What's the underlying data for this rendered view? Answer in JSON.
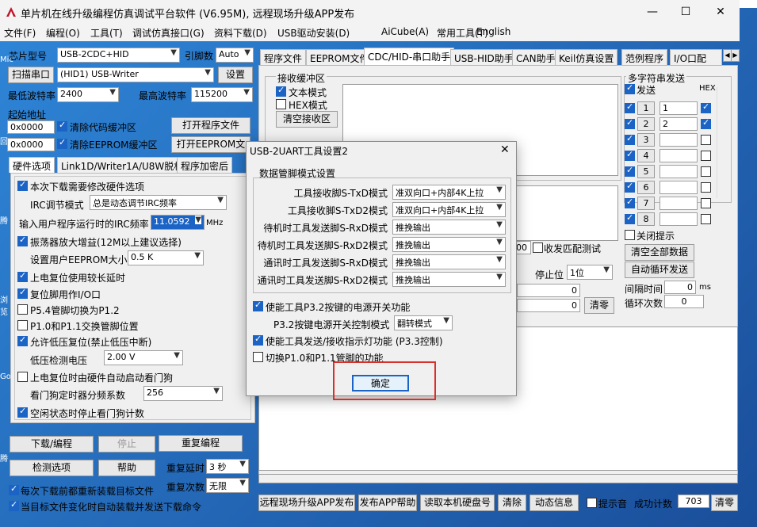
{
  "window": {
    "title": "单片机在线升级编程仿真调试平台软件 (V6.95M), 远程现场升级APP发布",
    "min": "—",
    "max": "☐",
    "close": "✕"
  },
  "desktop": {
    "icons": [
      "Mic",
      "回",
      "腾",
      "浏览",
      "Go",
      "腾"
    ]
  },
  "menu": [
    "文件(F)",
    "编程(O)",
    "工具(T)",
    "调试仿真接口(G)",
    "资料下载(D)",
    "USB驱动安装(D)",
    "AiCube(A)",
    "常用工具(T)",
    "English"
  ],
  "left": {
    "chip_label": "芯片型号",
    "chip_value": "USB-2CDC+HID",
    "pin_label": "引脚数",
    "pin_value": "Auto",
    "scan_button": "扫描串口",
    "port_value": "(HID1) USB-Writer",
    "settings_button": "设置",
    "min_baud_label": "最低波特率",
    "min_baud_value": "2400",
    "max_baud_label": "最高波特率",
    "max_baud_value": "115200",
    "start_addr_label": "起始地址",
    "addr1": "0x0000",
    "clear_code": "清除代码缓冲区",
    "open_prog": "打开程序文件",
    "addr2": "0x0000",
    "clear_eeprom": "清除EEPROM缓冲区",
    "open_eeprom": "打开EEPROM文",
    "tabs": [
      "硬件选项",
      "Link1D/Writer1A/U8W脱机",
      "程序加密后"
    ],
    "options": {
      "modify_hw": "本次下载需要修改硬件选项",
      "irc_label": "IRC调节模式",
      "irc_value": "总是动态调节IRC频率",
      "freq_label": "输入用户程序运行时的IRC频率",
      "freq_value": "11.0592",
      "freq_unit": "MHz",
      "osc_gain": "振荡器放大增益(12M以上建议选择)",
      "eeprom_label": "设置用户EEPROM大小",
      "eeprom_value": "0.5 K",
      "power_delay": "上电复位使用较长延时",
      "reset_io": "复位脚用作I/O口",
      "p54": "P5.4管脚切换为P1.2",
      "p10": "P1.0和P1.1交换管脚位置",
      "low_volt": "允许低压复位(禁止低压中断)",
      "low_volt_label": "低压检测电压",
      "low_volt_value": "2.00 V",
      "watchdog": "上电复位时由硬件自动启动看门狗",
      "wd_label": "看门狗定时器分频系数",
      "wd_value": "256",
      "idle_wd": "空闲状态时停止看门狗计数"
    },
    "download": "下载/编程",
    "stop": "停止",
    "reprog": "重复编程",
    "check": "检测选项",
    "help": "帮助",
    "repeat_delay_label": "重复延时",
    "repeat_delay_value": "3 秒",
    "repeat_count_label": "重复次数",
    "repeat_count_value": "无限",
    "reload": "每次下载前都重新装载目标文件",
    "auto_send": "当目标文件变化时自动装载并发送下载命令"
  },
  "right": {
    "tabs": [
      "程序文件",
      "EEPROM文件",
      "CDC/HID-串口助手",
      "USB-HID助手",
      "CAN助手",
      "Keil仿真设置",
      "范例程序",
      "I/O口配"
    ],
    "recv_title": "接收缓冲区",
    "text_mode": "文本模式",
    "hex_mode": "HEX模式",
    "clear_recv": "清空接收区",
    "recv_count": "100",
    "recv_match": "收发匹配测试",
    "stop_label": "停止位",
    "stop_value": "1位",
    "zero1": "0",
    "zero2": "0",
    "clear_count": "清零",
    "multi_title": "多字符串发送",
    "send_col": "发送",
    "hex_col": "HEX",
    "rows": [
      {
        "n": "1",
        "v": "1",
        "hex": true
      },
      {
        "n": "2",
        "v": "2",
        "hex": true
      },
      {
        "n": "3",
        "v": "",
        "hex": false
      },
      {
        "n": "4",
        "v": "",
        "hex": false
      },
      {
        "n": "5",
        "v": "",
        "hex": false
      },
      {
        "n": "6",
        "v": "",
        "hex": false
      },
      {
        "n": "7",
        "v": "",
        "hex": false
      },
      {
        "n": "8",
        "v": "",
        "hex": false
      }
    ],
    "close_hint": "关闭提示",
    "clear_all": "清空全部数据",
    "auto_loop": "自动循环发送",
    "interval_label": "间隔时间",
    "interval_value": "0",
    "interval_unit": "ms",
    "loop_label": "循环次数",
    "loop_value": "0"
  },
  "bottom": {
    "remote": "远程现场升级APP发布",
    "publish_help": "发布APP帮助",
    "read_disk": "读取本机硬盘号",
    "clear": "清除",
    "dynamic": "动态信息",
    "hint": "提示音",
    "success_label": "成功计数",
    "success_value": "703",
    "reset": "清零"
  },
  "dialog": {
    "title": "USB-2UART工具设置2",
    "close": "✕",
    "group": "数据管脚模式设置",
    "rows": [
      {
        "label": "工具接收脚S-TxD模式",
        "value": "准双向口+内部4K上拉"
      },
      {
        "label": "工具接收脚S-TxD2模式",
        "value": "准双向口+内部4K上拉"
      },
      {
        "label": "待机时工具发送脚S-RxD模式",
        "value": "推挽输出"
      },
      {
        "label": "待机时工具发送脚S-RxD2模式",
        "value": "推挽输出"
      },
      {
        "label": "通讯时工具发送脚S-RxD模式",
        "value": "推挽输出"
      },
      {
        "label": "通讯时工具发送脚S-RxD2模式",
        "value": "推挽输出"
      }
    ],
    "power_switch": "使能工具P3.2按键的电源开关功能",
    "p32_label": "P3.2按键电源开关控制模式",
    "p32_value": "翻转模式",
    "led": "使能工具发送/接收指示灯功能 (P3.3控制)",
    "p10_switch": "切换P1.0和P1.1管脚的功能",
    "ok": "确定"
  }
}
